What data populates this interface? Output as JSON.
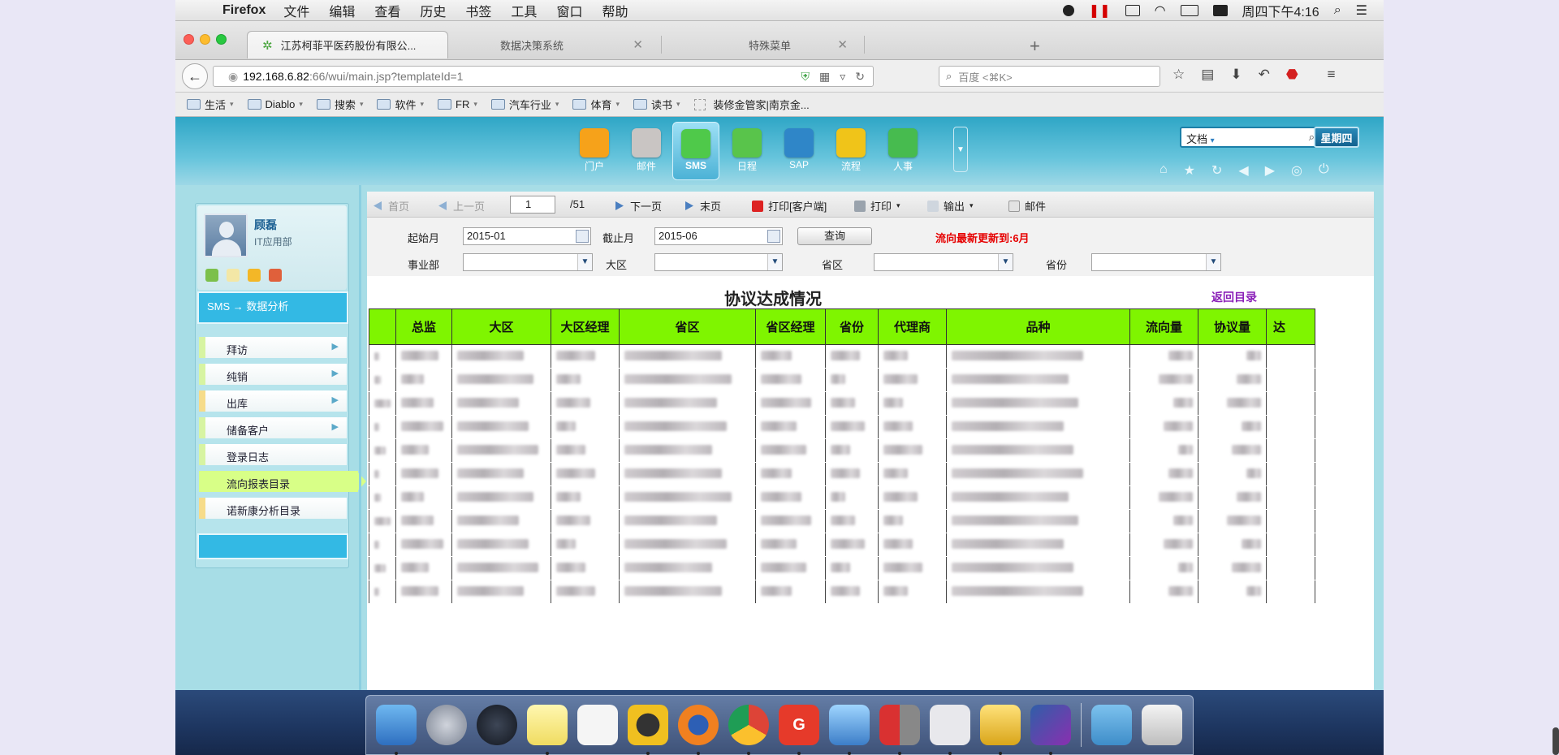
{
  "menubar": {
    "app_name": "Firefox",
    "items": [
      "文件",
      "编辑",
      "查看",
      "历史",
      "书签",
      "工具",
      "窗口",
      "帮助"
    ],
    "clock": "周四下午4:16"
  },
  "tabs": [
    {
      "label": "江苏柯菲平医药股份有限公..."
    },
    {
      "label": "数据决策系统"
    },
    {
      "label": "特殊菜单"
    }
  ],
  "address": {
    "host": "192.168.6.82",
    "path": ":66/wui/main.jsp?templateId=1"
  },
  "search": {
    "placeholder": "百度 <⌘K>"
  },
  "bookmarks": [
    {
      "label": "生活",
      "has_menu": true
    },
    {
      "label": "Diablo",
      "has_menu": true
    },
    {
      "label": "搜索",
      "has_menu": true
    },
    {
      "label": "软件",
      "has_menu": true
    },
    {
      "label": "FR",
      "has_menu": true
    },
    {
      "label": "汽车行业",
      "has_menu": true
    },
    {
      "label": "体育",
      "has_menu": true
    },
    {
      "label": "读书",
      "has_menu": true
    },
    {
      "label": "装修金管家|南京金...",
      "has_menu": false
    }
  ],
  "header": {
    "modules": [
      {
        "label": "门户",
        "color": "#f6a21a"
      },
      {
        "label": "邮件",
        "color": "#c9c5c3"
      },
      {
        "label": "SMS",
        "color": "#4fc94a"
      },
      {
        "label": "日程",
        "color": "#59c44b"
      },
      {
        "label": "SAP",
        "color": "#2f86c8"
      },
      {
        "label": "流程",
        "color": "#f0c419"
      },
      {
        "label": "人事",
        "color": "#47bb4f"
      }
    ],
    "search_type": "文档",
    "weekday": "星期四"
  },
  "user": {
    "name": "顾磊",
    "dept": "IT应用部"
  },
  "breadcrumb": {
    "module": "SMS",
    "arrow": "→",
    "page": "数据分析"
  },
  "left_nav": [
    {
      "label": "拜访",
      "arrow": "▶"
    },
    {
      "label": "纯销",
      "arrow": "▶"
    },
    {
      "label": "出库",
      "arrow": "▶"
    },
    {
      "label": "储备客户",
      "arrow": "▶"
    },
    {
      "label": "登录日志",
      "arrow": ""
    },
    {
      "label": "流向报表目录",
      "arrow": ""
    },
    {
      "label": "诺新康分析目录",
      "arrow": ""
    }
  ],
  "toolbar": {
    "first": "首页",
    "prev": "上一页",
    "page": "1",
    "total": "/51",
    "next": "下一页",
    "last": "末页",
    "print_client": "打印[客户端]",
    "print": "打印",
    "export": "输出",
    "mail": "邮件"
  },
  "filters": {
    "start_label": "起始月",
    "start_value": "2015-01",
    "end_label": "截止月",
    "end_value": "2015-06",
    "query": "查询",
    "notice": "流向最新更新到:6月",
    "division_label": "事业部",
    "region_label": "大区",
    "province_area_label": "省区",
    "province_label": "省份"
  },
  "report": {
    "title": "协议达成情况",
    "back": "返回目录",
    "columns": [
      "总监",
      "大区",
      "大区经理",
      "省区",
      "省区经理",
      "省份",
      "代理商",
      "品种",
      "流向量",
      "协议量",
      "达"
    ]
  }
}
